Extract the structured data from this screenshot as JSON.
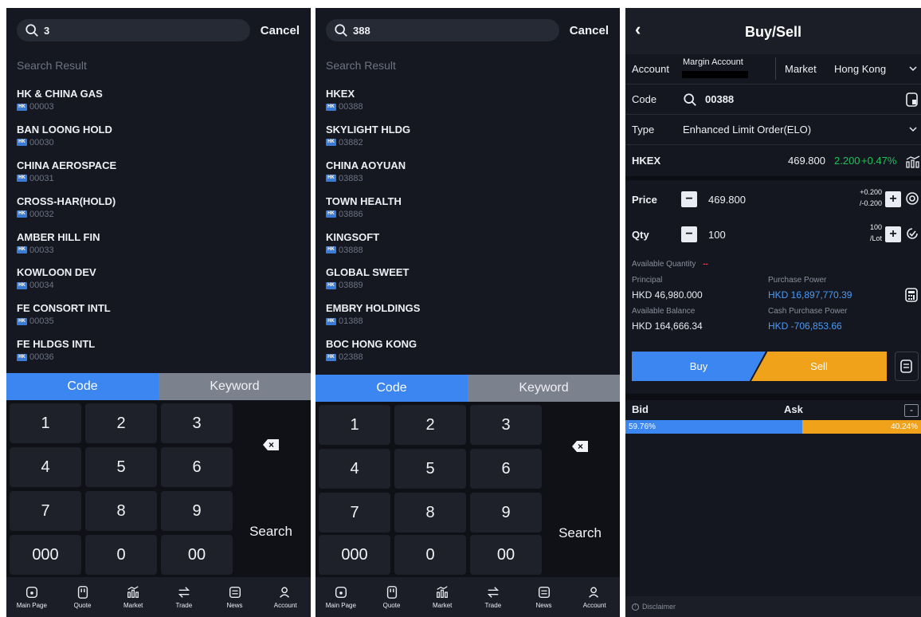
{
  "screen1": {
    "query": "3",
    "cancel": "Cancel",
    "result_header": "Search Result",
    "results": [
      {
        "name": "HK & CHINA GAS",
        "code": "00003"
      },
      {
        "name": "BAN LOONG HOLD",
        "code": "00030"
      },
      {
        "name": "CHINA AEROSPACE",
        "code": "00031"
      },
      {
        "name": "CROSS-HAR(HOLD)",
        "code": "00032"
      },
      {
        "name": "AMBER HILL FIN",
        "code": "00033"
      },
      {
        "name": "KOWLOON DEV",
        "code": "00034"
      },
      {
        "name": "FE CONSORT INTL",
        "code": "00035"
      },
      {
        "name": "FE HLDGS INTL",
        "code": "00036"
      }
    ]
  },
  "screen2": {
    "query": "388",
    "cancel": "Cancel",
    "result_header": "Search Result",
    "results": [
      {
        "name": "HKEX",
        "code": "00388"
      },
      {
        "name": "SKYLIGHT HLDG",
        "code": "03882"
      },
      {
        "name": "CHINA AOYUAN",
        "code": "03883"
      },
      {
        "name": "TOWN HEALTH",
        "code": "03886"
      },
      {
        "name": "KINGSOFT",
        "code": "03888"
      },
      {
        "name": "GLOBAL SWEET",
        "code": "03889"
      },
      {
        "name": "EMBRY HOLDINGS",
        "code": "01388"
      },
      {
        "name": "BOC HONG KONG",
        "code": "02388"
      }
    ]
  },
  "market_badge": "HK",
  "tabs": {
    "code": "Code",
    "keyword": "Keyword"
  },
  "keypad": {
    "k1": "1",
    "k2": "2",
    "k3": "3",
    "k4": "4",
    "k5": "5",
    "k6": "6",
    "k7": "7",
    "k8": "8",
    "k9": "9",
    "k000": "000",
    "k0": "0",
    "k00": "00",
    "search": "Search",
    "delete_icon": "backspace-icon"
  },
  "nav": [
    {
      "label": "Main Page",
      "icon": "home-icon"
    },
    {
      "label": "Quote",
      "icon": "quote-icon"
    },
    {
      "label": "Market",
      "icon": "market-icon"
    },
    {
      "label": "Trade",
      "icon": "trade-icon"
    },
    {
      "label": "News",
      "icon": "news-icon"
    },
    {
      "label": "Account",
      "icon": "account-icon"
    }
  ],
  "trade": {
    "title": "Buy/Sell",
    "account_label": "Account",
    "account_value": "Margin Account",
    "market_label": "Market",
    "market_value": "Hong Kong",
    "code_label": "Code",
    "code_value": "00388",
    "type_label": "Type",
    "type_value": "Enhanced Limit Order(ELO)",
    "stock_name": "HKEX",
    "last_price": "469.800",
    "change": "2.200",
    "change_pct": "+0.47%",
    "price_label": "Price",
    "price_value": "469.800",
    "spread_up": "+0.200",
    "spread_down": "/-0.200",
    "qty_label": "Qty",
    "qty_value": "100",
    "lot_size": "100",
    "lot_unit": "/Lot",
    "avail_qty_label": "Available Quantity",
    "avail_qty_value": "--",
    "principal_label": "Principal",
    "principal_value": "HKD 46,980.000",
    "purchase_power_label": "Purchase Power",
    "purchase_power_value": "HKD 16,897,770.39",
    "avail_balance_label": "Available Balance",
    "avail_balance_value": "HKD 164,666.34",
    "cash_pp_label": "Cash Purchase Power",
    "cash_pp_value": "HKD -706,853.66",
    "buy": "Buy",
    "sell": "Sell",
    "bid_label": "Bid",
    "ask_label": "Ask",
    "collapse": "-",
    "bid_pct": "59.76%",
    "ask_pct": "40.24%",
    "bid_ratio": 0.5976,
    "disclaimer": "Disclaimer",
    "colors": {
      "accent": "#3b86f0",
      "sell": "#f0a21b",
      "up": "#1fc25a",
      "info": "#4a9af5"
    }
  }
}
